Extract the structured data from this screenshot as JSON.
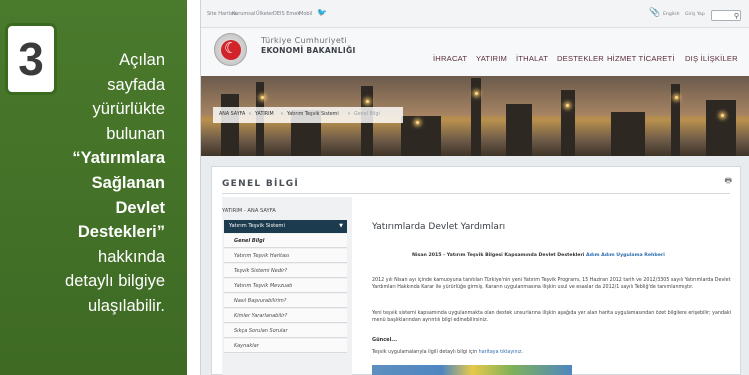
{
  "callout": {
    "number": "3",
    "line1": "Açılan",
    "line2": "sayfada",
    "line3": "yürürlükte",
    "line4": "bulunan",
    "bold1": "“Yatırımlara",
    "bold2": "Sağlanan",
    "bold3": "Devlet",
    "bold4": "Destekleri”",
    "line5": "hakkında",
    "line6": "detaylı bilgiye",
    "line7": "ulaşılabilir."
  },
  "topbar": {
    "links": [
      "Site Haritası",
      "Kurumsal",
      "Ülkeler",
      "DEIS Emek",
      "Mobil"
    ],
    "lang": "English",
    "login": "Giriş Yap"
  },
  "header": {
    "brand_line1": "Türkiye Cumhuriyeti",
    "brand_line2": "EKONOMİ BAKANLIĞI",
    "nav": [
      "İHRACAT",
      "YATIRIM",
      "İTHALAT",
      "DESTEKLER",
      "HİZMET TİCARETİ",
      "DIŞ İLİŞKİLER"
    ]
  },
  "breadcrumb": [
    "ANA SAYFA",
    "YATIRIM",
    "Yatırım Teşvik Sistemi",
    "Genel Bilgi"
  ],
  "section": {
    "title": "GENEL BİLGİ"
  },
  "sidebar": {
    "top": "YATIRIM - ANA SAYFA",
    "selected": "Yatırım Teşvik Sistemi",
    "items": [
      "Genel Bilgi",
      "Yatırım Teşvik Haritası",
      "Teşvik Sistemi Nedir?",
      "Yatırım Teşvik Mevzuatı",
      "Nasıl Başvurabilirim?",
      "Kimler Yararlanabilir?",
      "Sıkça Sorulan Sorular",
      "Kaynaklar"
    ]
  },
  "main": {
    "title": "Yatırımlarda Devlet Yardımları",
    "subtitle": "Nisan 2015 - Yatırım Teşvik Bilgesi Kapsamında Devlet Destekleri",
    "subtitle_link": "Adım Adım Uygulama Rehberi",
    "para1": "2012 yılı Nisan ayı içinde kamuoyuna tanıtılan Türkiye'nin yeni Yatırım Teşvik Programı, 15 Haziran 2012 tarih ve 2012/3305 sayılı Yatırımlarda Devlet Yardımları Hakkında Karar ile yürürlüğe girmiş. Kararın uygulanmasına ilişkin usul ve esaslar da 2012/1 sayılı Tebliğ'de tanımlanmıştır.",
    "para2": "Yeni teşvik sistemi kapsamında uygulanmakta olan destek unsurlarına ilişkin aşağıda yer alan harita uygulamasından özet bilgilere erişebilir; yandaki menü başlıklarından ayrıntılı bilgi edinebilirsiniz.",
    "guncel": "Güncel...",
    "para3": "Teşvik uygulamalarıyla ilgili detaylı bilgi için",
    "para3_link": "haritaya tıklayınız."
  }
}
